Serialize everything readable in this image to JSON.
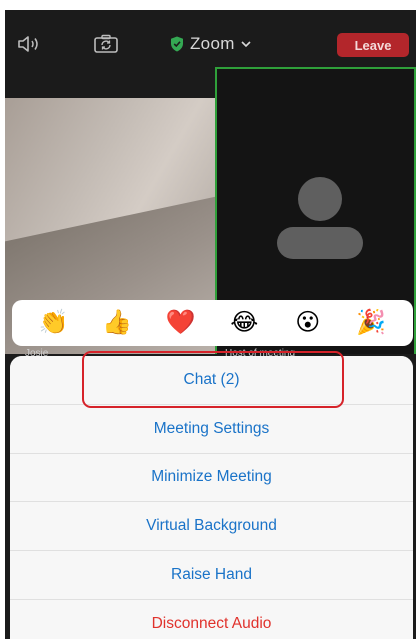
{
  "topbar": {
    "title": "Zoom",
    "leave_label": "Leave",
    "icons": [
      "speaker-icon",
      "camera-flip-icon",
      "shield-icon",
      "chevron-down-icon"
    ]
  },
  "video": {
    "left_name": "Josie",
    "right_name": "Host of meeting"
  },
  "reactions": [
    {
      "name": "clap",
      "glyph": "👏"
    },
    {
      "name": "thumbs-up",
      "glyph": "👍"
    },
    {
      "name": "heart",
      "glyph": "❤️"
    },
    {
      "name": "tears-of-joy",
      "glyph": "😂"
    },
    {
      "name": "surprised",
      "glyph": "😮"
    },
    {
      "name": "party",
      "glyph": "🎉"
    }
  ],
  "menu": {
    "items": [
      {
        "label": "Chat (2)"
      },
      {
        "label": "Meeting Settings"
      },
      {
        "label": "Minimize Meeting"
      },
      {
        "label": "Virtual Background"
      },
      {
        "label": "Raise Hand"
      },
      {
        "label": "Disconnect Audio"
      }
    ]
  },
  "colors": {
    "accent": "#1a73c8",
    "danger": "#e0322c",
    "leave": "#b3262b",
    "active_speaker": "#2fa03a",
    "highlight": "#d6232a"
  }
}
